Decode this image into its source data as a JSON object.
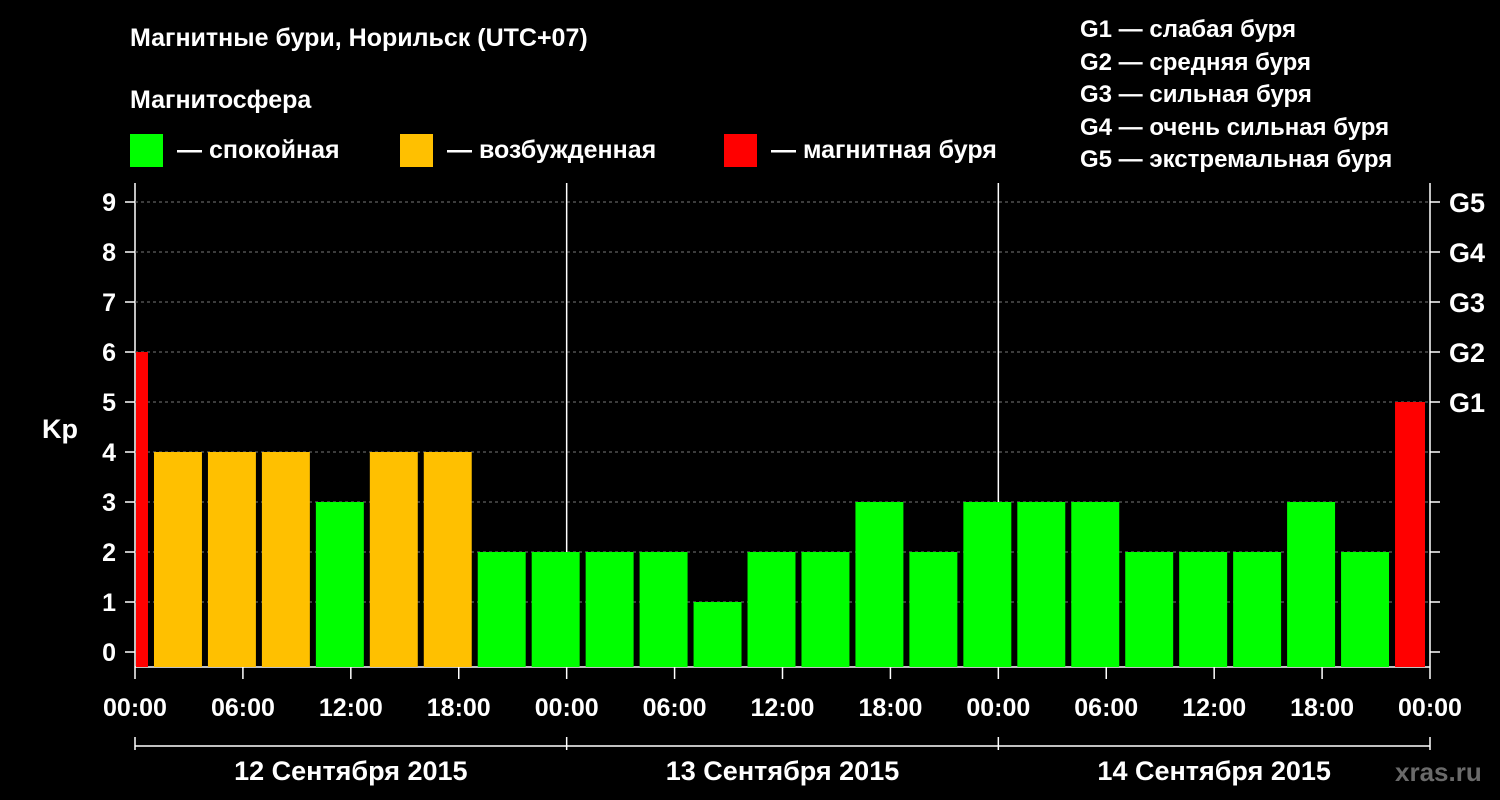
{
  "header": {
    "title": "Магнитные бури, Норильск (UTC+07)",
    "subtitle": "Магнитосфера"
  },
  "legend": [
    {
      "label": "— спокойная",
      "color": "#00ff00"
    },
    {
      "label": "— возбужденная",
      "color": "#ffc000"
    },
    {
      "label": "— магнитная буря",
      "color": "#ff0000"
    }
  ],
  "g_scale": [
    "G1 — слабая буря",
    "G2 — средняя буря",
    "G3 — сильная буря",
    "G4 — очень сильная буря",
    "G5 — экстремальная буря"
  ],
  "watermark": "xras.ru",
  "chart_data": {
    "type": "bar",
    "title": "Магнитные бури, Норильск (UTC+07)",
    "ylabel": "Kp",
    "ylim": [
      0,
      9
    ],
    "yticks": [
      "0",
      "1",
      "2",
      "3",
      "4",
      "5",
      "6",
      "7",
      "8",
      "9"
    ],
    "right_ticks": [
      {
        "value": 5,
        "label": "G1"
      },
      {
        "value": 6,
        "label": "G2"
      },
      {
        "value": 7,
        "label": "G3"
      },
      {
        "value": 8,
        "label": "G4"
      },
      {
        "value": 9,
        "label": "G5"
      }
    ],
    "x_hours_range": [
      0,
      72
    ],
    "xtick_labels": [
      "00:00",
      "06:00",
      "12:00",
      "18:00",
      "00:00",
      "06:00",
      "12:00",
      "18:00",
      "00:00",
      "06:00",
      "12:00",
      "18:00",
      "00:00"
    ],
    "dates": [
      "12 Сентября 2015",
      "13 Сентября 2015",
      "14 Сентября 2015"
    ],
    "grid": true,
    "colors": {
      "calm": "#00ff00",
      "excited": "#ffc000",
      "storm": "#ff0000"
    },
    "bars": [
      {
        "start": 0,
        "end": 1,
        "value": 6
      },
      {
        "start": 1,
        "end": 4,
        "value": 4
      },
      {
        "start": 4,
        "end": 7,
        "value": 4
      },
      {
        "start": 7,
        "end": 10,
        "value": 4
      },
      {
        "start": 10,
        "end": 13,
        "value": 3
      },
      {
        "start": 13,
        "end": 16,
        "value": 4
      },
      {
        "start": 16,
        "end": 19,
        "value": 4
      },
      {
        "start": 19,
        "end": 22,
        "value": 2
      },
      {
        "start": 22,
        "end": 25,
        "value": 2
      },
      {
        "start": 25,
        "end": 28,
        "value": 2
      },
      {
        "start": 28,
        "end": 31,
        "value": 2
      },
      {
        "start": 31,
        "end": 34,
        "value": 1
      },
      {
        "start": 34,
        "end": 37,
        "value": 2
      },
      {
        "start": 37,
        "end": 40,
        "value": 2
      },
      {
        "start": 40,
        "end": 43,
        "value": 3
      },
      {
        "start": 43,
        "end": 46,
        "value": 2
      },
      {
        "start": 46,
        "end": 49,
        "value": 3
      },
      {
        "start": 49,
        "end": 52,
        "value": 3
      },
      {
        "start": 52,
        "end": 55,
        "value": 3
      },
      {
        "start": 55,
        "end": 58,
        "value": 2
      },
      {
        "start": 58,
        "end": 61,
        "value": 2
      },
      {
        "start": 61,
        "end": 64,
        "value": 2
      },
      {
        "start": 64,
        "end": 67,
        "value": 3
      },
      {
        "start": 67,
        "end": 70,
        "value": 2
      },
      {
        "start": 70,
        "end": 72,
        "value": 5
      }
    ]
  }
}
